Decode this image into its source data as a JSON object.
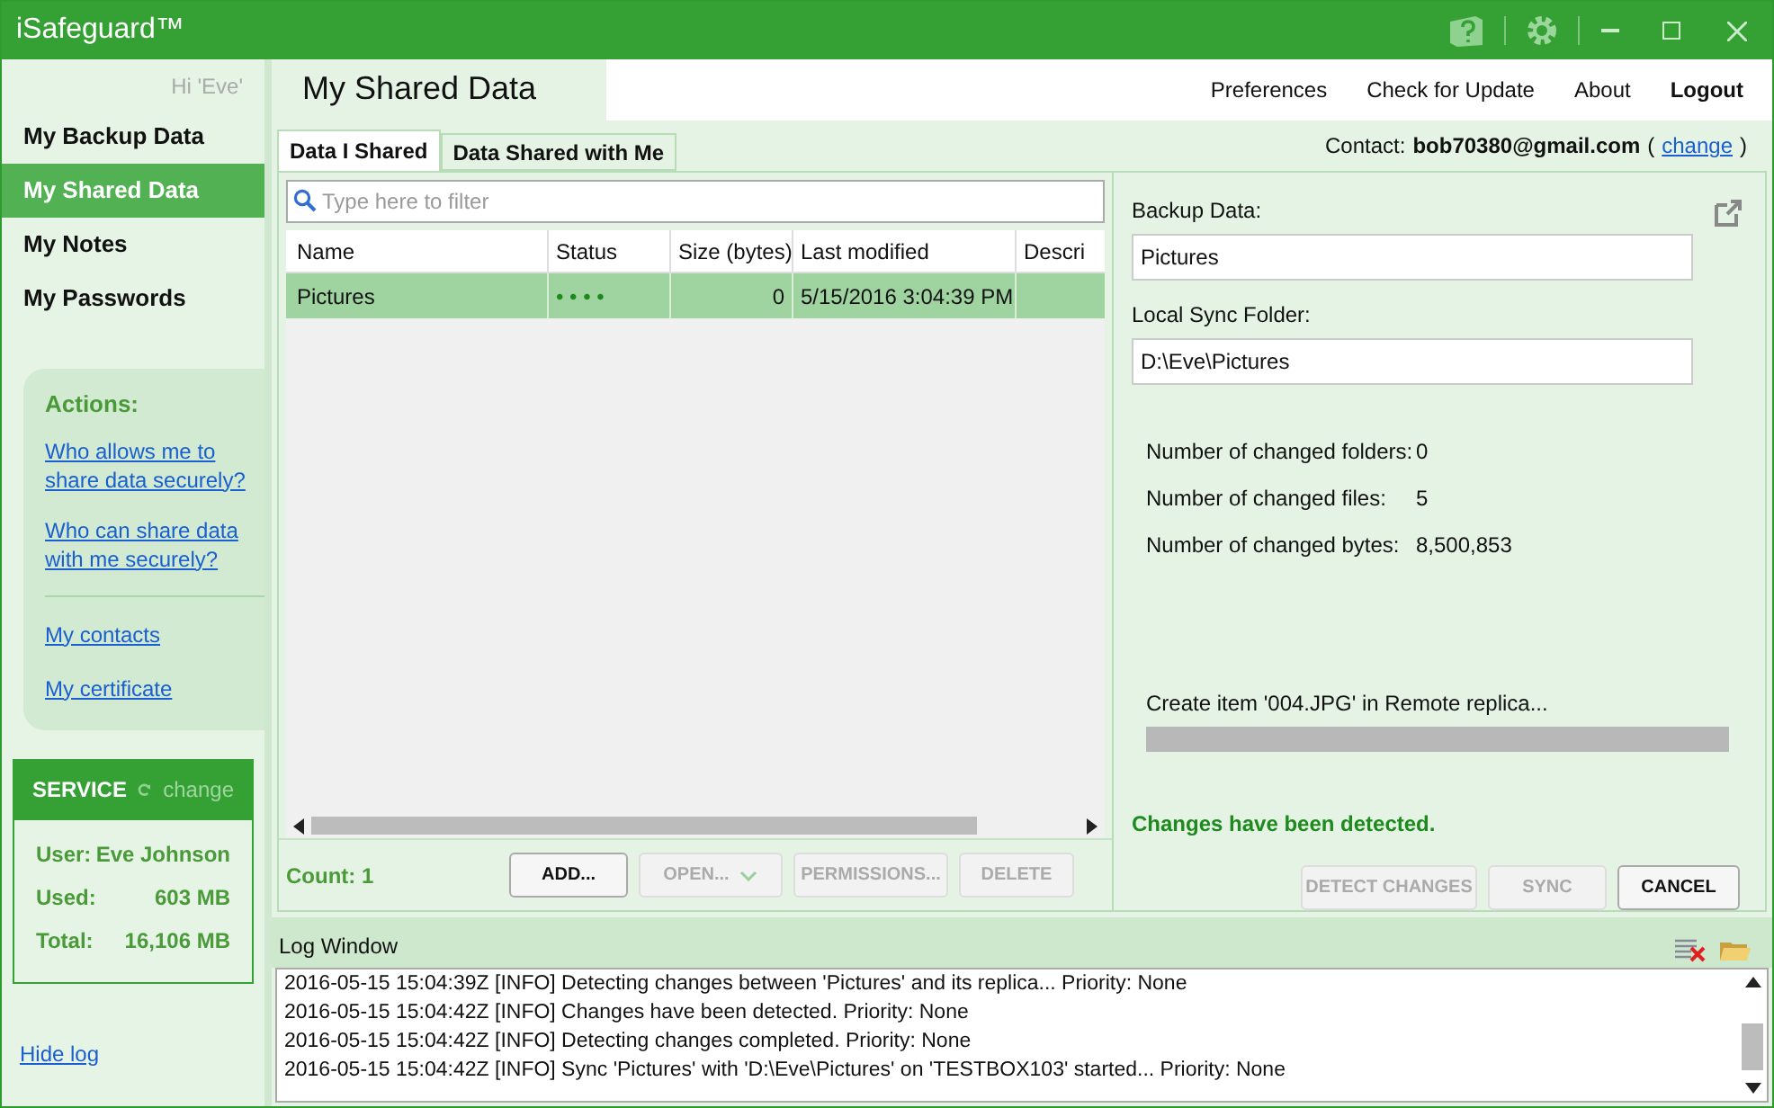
{
  "window": {
    "title": "iSafeguard™"
  },
  "sidebar": {
    "greeting": "Hi 'Eve'",
    "items": [
      {
        "label": "My Backup Data",
        "selected": false
      },
      {
        "label": "My Shared Data",
        "selected": true
      },
      {
        "label": "My Notes",
        "selected": false
      },
      {
        "label": "My Passwords",
        "selected": false
      }
    ],
    "actions": {
      "title": "Actions:",
      "links": [
        "Who allows me to share data securely?",
        "Who can share data with me securely?"
      ],
      "more_links": [
        "My contacts",
        "My certificate"
      ]
    },
    "service": {
      "title": "SERVICE",
      "change": "change",
      "rows": [
        {
          "label": "User:",
          "value": "Eve Johnson"
        },
        {
          "label": "Used:",
          "value": "603 MB"
        },
        {
          "label": "Total:",
          "value": "16,106 MB"
        }
      ]
    },
    "hide_log": "Hide log"
  },
  "page_title": "My Shared Data",
  "top_menu": [
    {
      "label": "Preferences",
      "bold": false
    },
    {
      "label": "Check for Update",
      "bold": false
    },
    {
      "label": "About",
      "bold": false
    },
    {
      "label": "Logout",
      "bold": true
    }
  ],
  "contact": {
    "label": "Contact:",
    "email": "bob70380@gmail.com",
    "open": "(",
    "link": "change",
    "close": ")"
  },
  "tabs": [
    {
      "label": "Data I Shared",
      "selected": true
    },
    {
      "label": "Data Shared with Me",
      "selected": false
    }
  ],
  "filter": {
    "placeholder": "Type here to filter"
  },
  "table": {
    "columns": [
      "Name",
      "Status",
      "Size (bytes)",
      "Last modified",
      "Descri"
    ],
    "rows": [
      {
        "cells": [
          "Pictures",
          "• • • •",
          "0",
          "5/15/2016 3:04:39 PM"
        ],
        "selected": true
      }
    ]
  },
  "count": "Count: 1",
  "list_buttons": [
    {
      "label": "ADD...",
      "disabled": false,
      "dropdown": false
    },
    {
      "label": "OPEN...",
      "disabled": true,
      "dropdown": true
    },
    {
      "label": "PERMISSIONS...",
      "disabled": true,
      "dropdown": false
    },
    {
      "label": "DELETE",
      "disabled": true,
      "dropdown": false
    }
  ],
  "details": {
    "fields": [
      {
        "label": "Backup Data:",
        "value": "Pictures"
      },
      {
        "label": "Local Sync Folder:",
        "value": "D:\\Eve\\Pictures"
      }
    ],
    "stats": [
      {
        "label": "Number of changed folders:",
        "value": "0"
      },
      {
        "label": "Number of changed files:",
        "value": "5"
      },
      {
        "label": "Number of changed bytes:",
        "value": "8,500,853"
      }
    ],
    "progress_text": "Create item '004.JPG' in Remote replica...",
    "progress": {
      "level": 0
    },
    "status": "Changes have been detected.",
    "buttons": [
      {
        "label": "DETECT CHANGES",
        "disabled": true
      },
      {
        "label": "SYNC",
        "disabled": true
      },
      {
        "label": "CANCEL",
        "disabled": false
      }
    ]
  },
  "log": {
    "title": "Log Window",
    "lines": [
      "2016-05-15 15:04:39Z [INFO] Detecting changes between 'Pictures' and its replica... Priority: None",
      "2016-05-15 15:04:42Z [INFO] Changes have been detected. Priority: None",
      "2016-05-15 15:04:42Z [INFO] Detecting changes completed. Priority: None",
      "2016-05-15 15:04:42Z [INFO] Sync 'Pictures' with 'D:\\Eve\\Pictures' on 'TESTBOX103' started... Priority: None"
    ]
  }
}
